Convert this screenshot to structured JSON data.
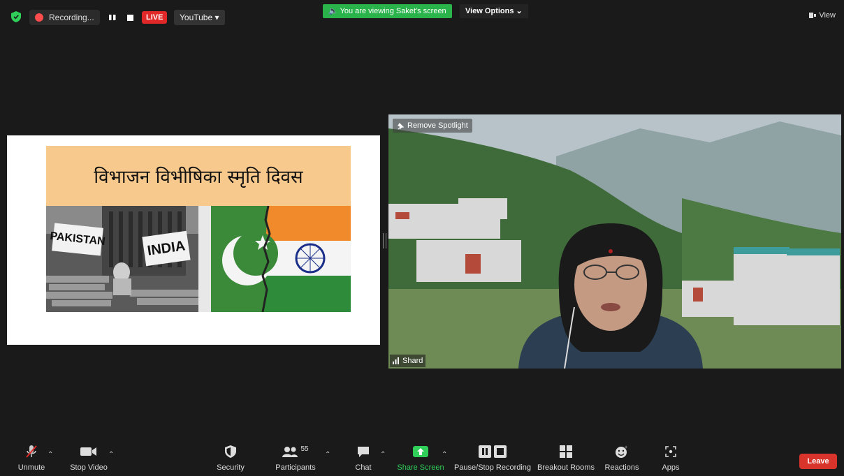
{
  "topbar": {
    "recording_label": "Recording...",
    "live_label": "LIVE",
    "stream_target": "YouTube",
    "viewing_banner": "You are viewing Saket's screen",
    "view_options_label": "View Options",
    "view_label": "View"
  },
  "slide": {
    "title": "विभाजन विभीषिका स्मृति दिवस",
    "sign_left": "PAKISTAN",
    "sign_right": "INDIA"
  },
  "video": {
    "remove_spotlight_label": "Remove Spotlight",
    "participant_name": "Shard"
  },
  "toolbar": {
    "unmute": "Unmute",
    "stop_video": "Stop Video",
    "security": "Security",
    "participants": "Participants",
    "participant_count": "55",
    "chat": "Chat",
    "share_screen": "Share Screen",
    "pause_stop_recording": "Pause/Stop Recording",
    "breakout_rooms": "Breakout Rooms",
    "reactions": "Reactions",
    "apps": "Apps",
    "leave": "Leave"
  },
  "colors": {
    "background": "#1a1a1a",
    "live_red": "#e02828",
    "viewing_green": "#29b34a",
    "share_green": "#2fcf5a",
    "leave_red": "#d9342b",
    "slide_banner": "#f7c98d"
  }
}
